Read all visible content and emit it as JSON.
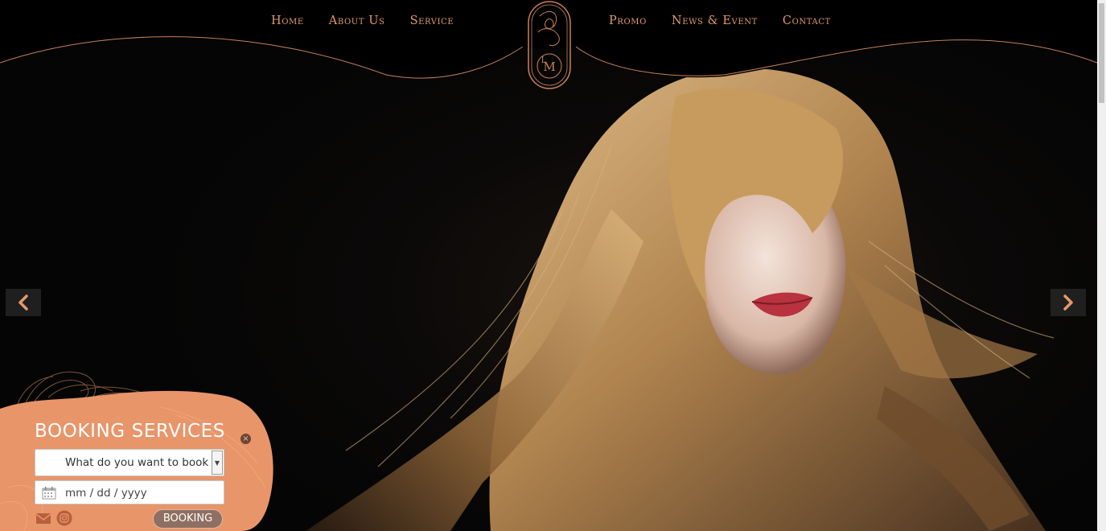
{
  "nav": {
    "left": [
      {
        "label": "Home"
      },
      {
        "label": "About Us"
      },
      {
        "label": "Service"
      }
    ],
    "right": [
      {
        "label": "Promo"
      },
      {
        "label": "News & Event"
      },
      {
        "label": "Contact"
      }
    ]
  },
  "logo": {
    "icon": "monogram-logo-icon"
  },
  "carousel": {
    "prev_icon": "chevron-left-icon",
    "next_icon": "chevron-right-icon"
  },
  "booking": {
    "title": "BOOKING SERVICES",
    "close_icon": "close-icon",
    "service_select": {
      "selected": "What do you want to book"
    },
    "date_input": {
      "placeholder": "mm / dd / yyyy",
      "icon": "calendar-icon"
    },
    "social": [
      {
        "icon": "mail-icon"
      },
      {
        "icon": "instagram-icon"
      }
    ],
    "submit_label": "BOOKING"
  },
  "colors": {
    "accent": "#e29a6c",
    "booking_panel": "#e8956a",
    "background": "#050505"
  }
}
